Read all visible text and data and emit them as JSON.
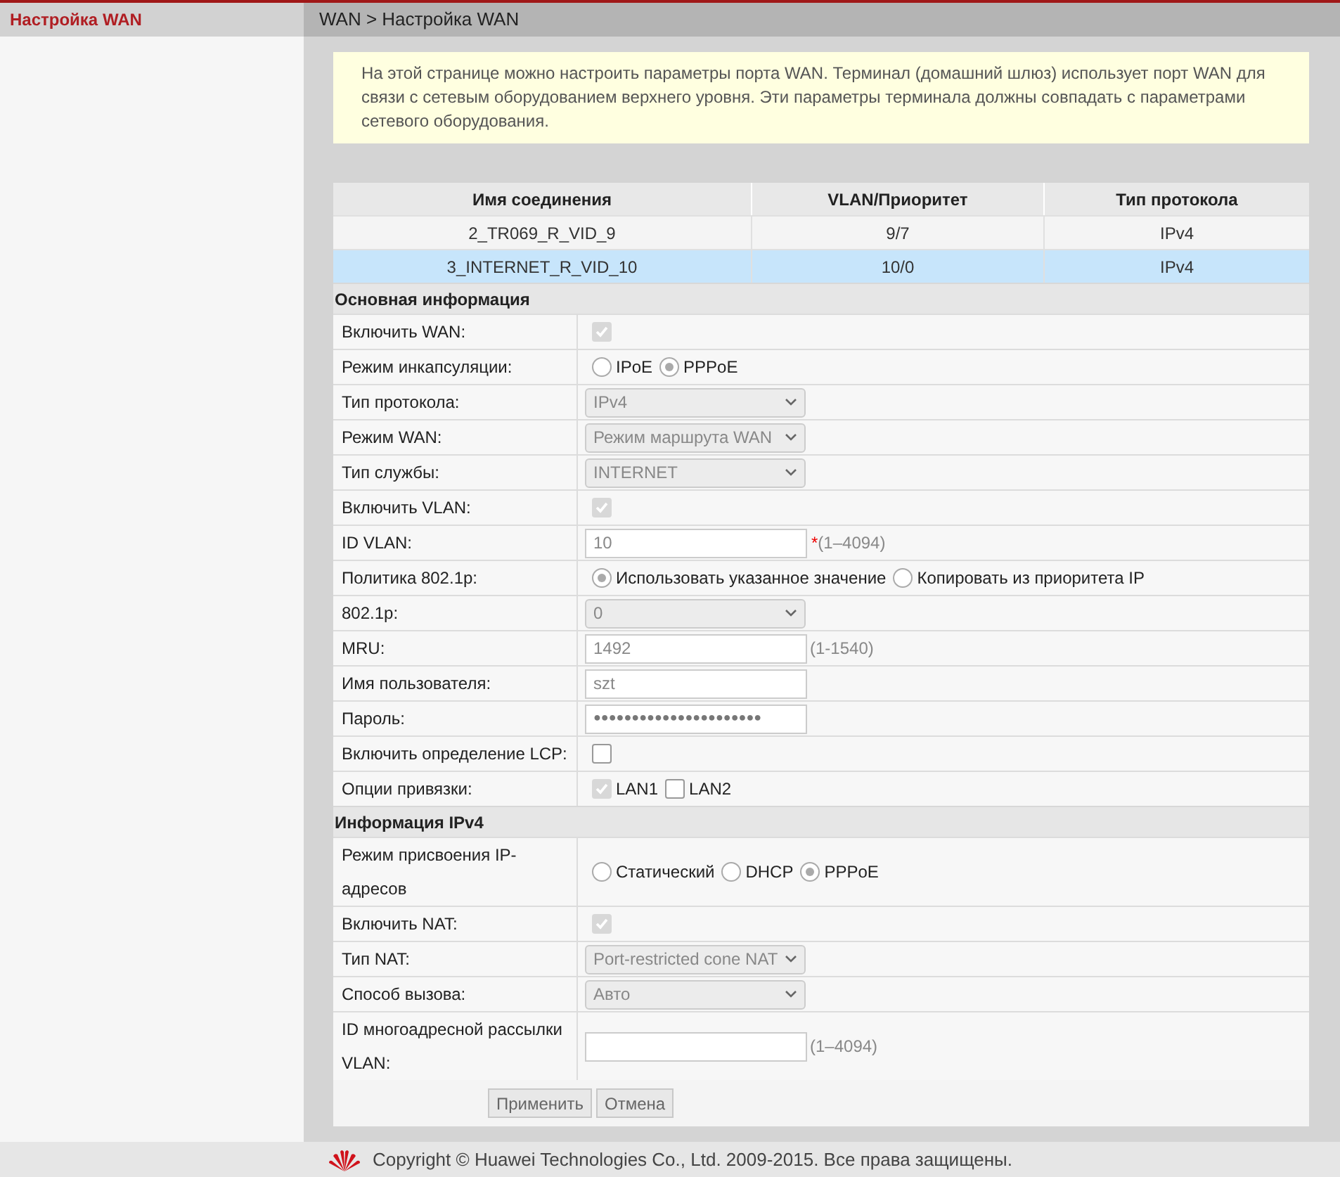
{
  "sidebar": {
    "items": [
      {
        "label": "Настройка WAN",
        "selected": true
      }
    ]
  },
  "breadcrumb": "WAN > Настройка WAN",
  "info": "На этой странице можно настроить параметры порта WAN. Терминал (домашний шлюз) использует порт WAN для связи с сетевым оборудованием верхнего уровня. Эти параметры терминала должны совпадать с параметрами сетевого оборудования.",
  "table": {
    "columns": [
      "Имя соединения",
      "VLAN/Приоритет",
      "Тип протокола"
    ],
    "rows": [
      {
        "cells": [
          "2_TR069_R_VID_9",
          "9/7",
          "IPv4"
        ],
        "selected": false
      },
      {
        "cells": [
          "3_INTERNET_R_VID_10",
          "10/0",
          "IPv4"
        ],
        "selected": true
      }
    ]
  },
  "sections": [
    {
      "title": "Основная информация",
      "rows": [
        {
          "label": "Включить WAN:",
          "kind": "checkbox",
          "checked": true,
          "disabled": true
        },
        {
          "label": "Режим инкапсуляции:",
          "kind": "radio",
          "options": [
            {
              "label": "IPoE",
              "selected": false
            },
            {
              "label": "PPPoE",
              "selected": true
            }
          ]
        },
        {
          "label": "Тип протокола:",
          "kind": "select",
          "value": "IPv4"
        },
        {
          "label": "Режим WAN:",
          "kind": "select",
          "value": "Режим маршрута WAN"
        },
        {
          "label": "Тип службы:",
          "kind": "select",
          "value": "INTERNET"
        },
        {
          "label": "Включить VLAN:",
          "kind": "checkbox",
          "checked": true,
          "disabled": true
        },
        {
          "label": "ID VLAN:",
          "kind": "text",
          "value": "10",
          "required_mark": "*",
          "hint": "(1–4094)"
        },
        {
          "label": "Политика 802.1p:",
          "kind": "radio",
          "options": [
            {
              "label": "Использовать указанное значение",
              "selected": true
            },
            {
              "label": "Копировать из приоритета IP",
              "selected": false
            }
          ]
        },
        {
          "label": "802.1p:",
          "kind": "select",
          "value": "0"
        },
        {
          "label": "MRU:",
          "kind": "text",
          "value": "1492",
          "hint": "(1-1540)"
        },
        {
          "label": "Имя пользователя:",
          "kind": "text",
          "value": "szt"
        },
        {
          "label": "Пароль:",
          "kind": "password",
          "value": "●●●●●●●●●●●●●●●●●●●●●●"
        },
        {
          "label": "Включить определение LCP:",
          "kind": "checkbox",
          "checked": false,
          "disabled": false
        },
        {
          "label": "Опции привязки:",
          "kind": "checkboxes",
          "options": [
            {
              "label": "LAN1",
              "checked": true,
              "disabled": true
            },
            {
              "label": "LAN2",
              "checked": false,
              "disabled": false
            }
          ]
        }
      ]
    },
    {
      "title": "Информация IPv4",
      "rows": [
        {
          "label": "Режим присвоения IP-адресов",
          "kind": "radio",
          "tall": true,
          "options": [
            {
              "label": "Статический",
              "selected": false
            },
            {
              "label": "DHCP",
              "selected": false
            },
            {
              "label": "PPPoE",
              "selected": true
            }
          ]
        },
        {
          "label": "Включить NAT:",
          "kind": "checkbox",
          "checked": true,
          "disabled": true
        },
        {
          "label": "Тип NAT:",
          "kind": "select",
          "value": "Port-restricted cone NAT"
        },
        {
          "label": "Способ вызова:",
          "kind": "select",
          "value": "Авто"
        },
        {
          "label": "ID многоадресной рассылки VLAN:",
          "kind": "text",
          "value": "",
          "hint": "(1–4094)",
          "tall": true
        }
      ]
    }
  ],
  "buttons": [
    "Применить",
    "Отмена"
  ],
  "footer": "Copyright © Huawei Technologies Co., Ltd. 2009-2015. Все права защищены."
}
